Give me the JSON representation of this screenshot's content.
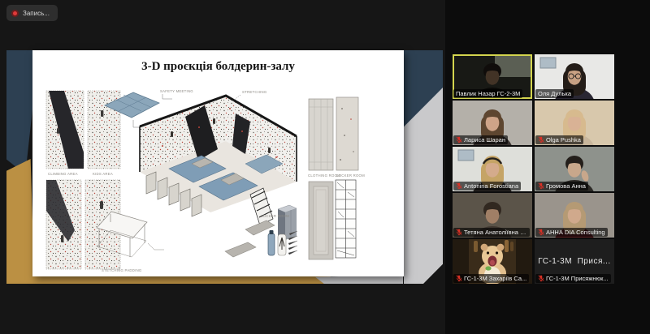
{
  "app": {
    "recording_label": "Запись...",
    "accent_active_border": "#d3d44e",
    "muted_mic_color": "#d93025"
  },
  "slide": {
    "title": "3-D проєкція болдерин-залу",
    "labels": {
      "safety": "SAFETY MEETING",
      "stretching": "STRETCHING",
      "area_left_1": "CLIMBING AREA",
      "area_left_2": "KIDS AREA",
      "clothing_room": "CLOTHING ROOM",
      "locker_room_panel": "LOCKER ROOM",
      "locker_room_cabinet": "LOCKER ROOM",
      "locker_room_small": "LOCKER ROOM",
      "sitting_room": "SITTING ROOM",
      "stretching_padding": "STETCHING PADDING"
    },
    "colors": {
      "navy": "#2d4052",
      "gold": "#bb9043",
      "silver": "#c9c9cb",
      "mat_blue": "#7f9db6",
      "wall": "#f0efeb"
    }
  },
  "participants": [
    {
      "name": "Павлик Назар ГС-2-3М",
      "muted": false,
      "active": true,
      "look": {
        "wall": "#23251f",
        "light": "#8e9383",
        "hair": "#171310",
        "skin": "#5f4937",
        "shirt": "#0f0d0b",
        "dim": 0.3
      }
    },
    {
      "name": "Оля Дулька",
      "muted": false,
      "active": false,
      "look": {
        "wall": "#e8e8e6",
        "hair": "#241d18",
        "skin": "#c9a183",
        "shirt": "#2a2733",
        "glasses": true,
        "long": true,
        "frame": true
      }
    },
    {
      "name": "Лариса Шаран",
      "muted": true,
      "active": false,
      "look": {
        "wall": "#b4b0a9",
        "hair": "#5e4630",
        "skin": "#cfa488",
        "shirt": "#3a3330",
        "long": true
      }
    },
    {
      "name": "Olga Pushka",
      "muted": true,
      "active": false,
      "look": {
        "wall": "#d8c8ac",
        "hair": "#d7ba8e",
        "skin": "#d9b295",
        "shirt": "#c8b69c",
        "long": true
      }
    },
    {
      "name": "Antonina Forostiana",
      "muted": true,
      "active": false,
      "look": {
        "wall": "#dedfda",
        "hair": "#c5a466",
        "skin": "#d4ab8c",
        "shirt": "#2f2b28",
        "headset": true,
        "long": true,
        "frame": true
      }
    },
    {
      "name": "Громова Анна",
      "muted": true,
      "active": false,
      "look": {
        "wall": "#8e928c",
        "hair": "#241f1b",
        "skin": "#c8a78b",
        "shirt": "#2c2a26",
        "hand": true
      }
    },
    {
      "name": "Тетяна Анатоліївна С...",
      "muted": true,
      "active": false,
      "look": {
        "wall": "#6b6356",
        "hair": "#3a2f26",
        "skin": "#bd9678",
        "shirt": "#4a4139",
        "dim": 0.15
      }
    },
    {
      "name": "АННА DIA Consulting",
      "muted": true,
      "active": false,
      "look": {
        "wall": "#9a948c",
        "hair": "#b59a74",
        "skin": "#d0a98c",
        "shirt": "#5a1f22",
        "long": true
      }
    },
    {
      "name": "ГС-1-3М Захаріїв Са...",
      "muted": true,
      "active": false,
      "avatar": "hamster"
    },
    {
      "name": "ГС-1-3М Присяжнюк...",
      "muted": true,
      "active": false,
      "camera_off": true,
      "center_text": "ГС-1-3М  Прися..."
    }
  ]
}
